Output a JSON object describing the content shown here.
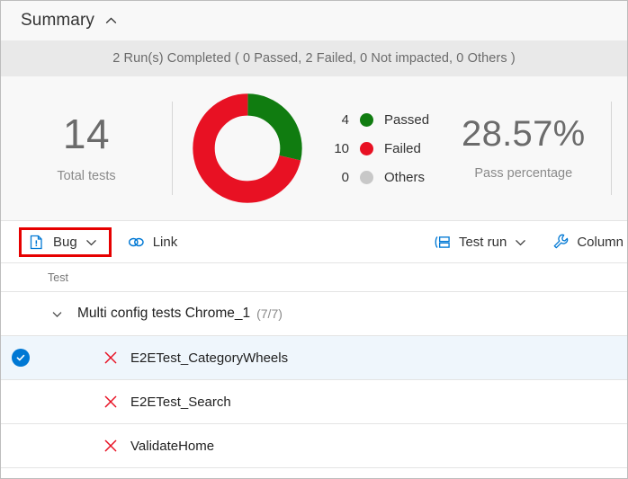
{
  "summary": {
    "title": "Summary",
    "collapse_icon": "chevron-up-icon",
    "run_status": "2 Run(s) Completed ( 0 Passed, 2 Failed, 0 Not impacted, 0 Others )",
    "total_tests": {
      "value": "14",
      "label": "Total tests"
    },
    "pass_percentage": {
      "value": "28.57%",
      "label": "Pass percentage"
    }
  },
  "chart_data": {
    "type": "pie",
    "title": "",
    "categories": [
      "Passed",
      "Failed",
      "Others"
    ],
    "values": [
      4,
      10,
      0
    ],
    "colors": [
      "#107c10",
      "#e81123",
      "#c8c8c8"
    ],
    "total": 14,
    "legend_position": "right",
    "donut": true
  },
  "legend": [
    {
      "count": "4",
      "label": "Passed",
      "color": "#107c10"
    },
    {
      "count": "10",
      "label": "Failed",
      "color": "#e81123"
    },
    {
      "count": "0",
      "label": "Others",
      "color": "#c8c8c8"
    }
  ],
  "toolbar": {
    "bug": {
      "label": "Bug",
      "icon": "bug-document-icon",
      "chevron": "chevron-down-icon"
    },
    "link": {
      "label": "Link",
      "icon": "link-chain-icon"
    },
    "test_run": {
      "label": "Test run",
      "icon": "group-by-icon",
      "chevron": "chevron-down-icon"
    },
    "column": {
      "label": "Column",
      "icon": "wrench-icon"
    },
    "annotation_color": "#e60000"
  },
  "table": {
    "columns": [
      "Test"
    ],
    "group": {
      "name": "Multi config tests Chrome_1",
      "count": "(7/7)",
      "expand_icon": "chevron-down-icon"
    },
    "rows": [
      {
        "name": "E2ETest_CategoryWheels",
        "status": "failed",
        "selected": true
      },
      {
        "name": "E2ETest_Search",
        "status": "failed",
        "selected": false
      },
      {
        "name": "ValidateHome",
        "status": "failed",
        "selected": false
      }
    ]
  },
  "colors": {
    "accent": "#0078d4",
    "pass": "#107c10",
    "fail": "#e81123",
    "other": "#c8c8c8",
    "annotation": "#e60000"
  }
}
